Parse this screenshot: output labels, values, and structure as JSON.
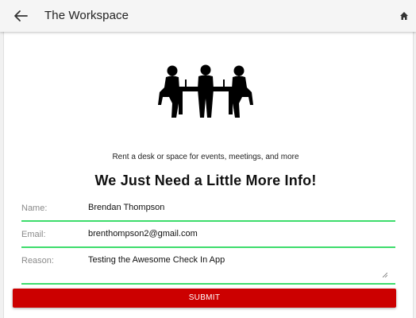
{
  "appbar": {
    "title": "The Workspace",
    "back_icon": "arrow-left-icon",
    "home_icon": "home-icon"
  },
  "hero": {
    "illustration": "meeting-table-icon",
    "tagline": "Rent a desk or space for events, meetings, and more",
    "heading": "We Just Need a Little More Info!"
  },
  "form": {
    "name": {
      "label": "Name:",
      "value": "Brendan Thompson"
    },
    "email": {
      "label": "Email:",
      "value": "brenthompson2@gmail.com"
    },
    "reason": {
      "label": "Reason:",
      "value": "Testing the Awesome Check In App"
    },
    "submit_label": "SUBMIT"
  },
  "colors": {
    "accent_underline": "#3ddc6c",
    "submit_background": "#cc0000",
    "appbar_background": "#f5f5f5"
  }
}
